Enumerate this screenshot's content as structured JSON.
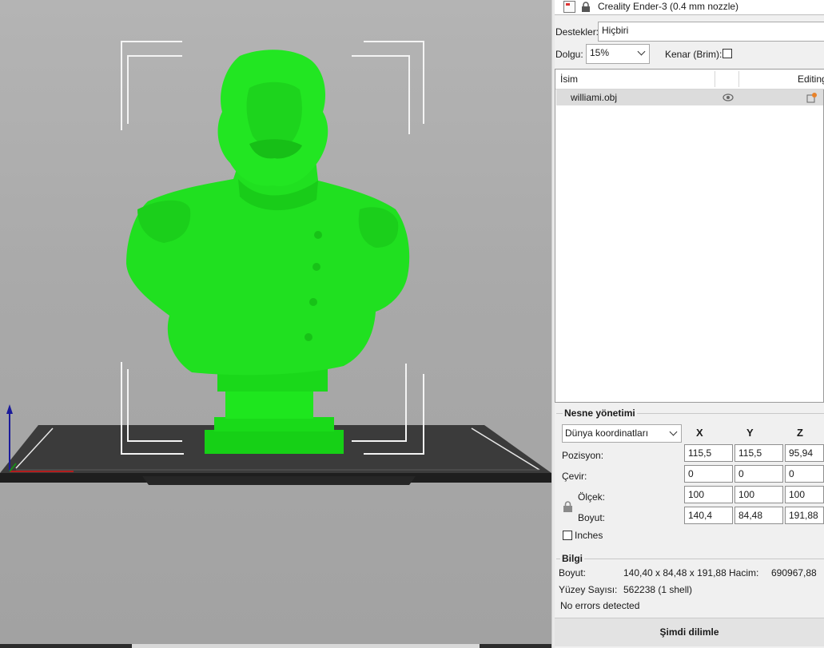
{
  "printer": {
    "name": "Creality Ender-3 (0.4 mm nozzle)"
  },
  "settings": {
    "supports_label": "Destekler:",
    "supports_value": "Hiçbiri",
    "infill_label": "Dolgu:",
    "infill_value": "15%",
    "brim_label": "Kenar (Brim):"
  },
  "object_list": {
    "col_name": "İsim",
    "col_editing": "Editing",
    "rows": [
      {
        "name": "williami.obj"
      }
    ]
  },
  "object_manipulation": {
    "title": "Nesne yönetimi",
    "coord_system": "Dünya koordinatları",
    "axes": [
      "X",
      "Y",
      "Z"
    ],
    "position_label": "Pozisyon:",
    "position": [
      "115,5",
      "115,5",
      "95,94"
    ],
    "rotation_label": "Çevir:",
    "rotation": [
      "0",
      "0",
      "0"
    ],
    "scale_label": "Ölçek:",
    "scale": [
      "100",
      "100",
      "100"
    ],
    "size_label": "Boyut:",
    "size": [
      "140,4",
      "84,48",
      "191,88"
    ],
    "inches_label": "Inches"
  },
  "info": {
    "title": "Bilgi",
    "size_label": "Boyut:",
    "size_value": "140,40 x 84,48 x 191,88",
    "volume_label": "Hacim:",
    "volume_value": "690967,88",
    "facets_label": "Yüzey Sayısı:",
    "facets_value": "562238 (1 shell)",
    "errors": "No errors detected"
  },
  "slice_button": "Şimdi dilimle",
  "colors": {
    "model": "#1ee61e",
    "viewport_bg": "#aaaaaa",
    "bed": "#3a3a3a"
  }
}
